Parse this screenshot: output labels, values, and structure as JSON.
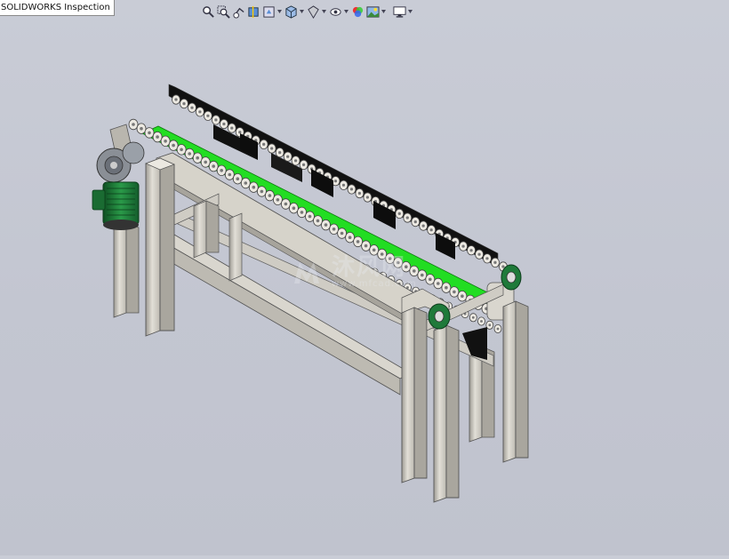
{
  "window": {
    "tab_label": "SOLIDWORKS Inspection"
  },
  "toolbar": {
    "buttons": [
      {
        "icon": "zoom-to-fit-icon"
      },
      {
        "icon": "zoom-to-area-icon"
      },
      {
        "icon": "previous-view-icon"
      },
      {
        "icon": "section-view-icon"
      },
      {
        "icon": "dynamic-annotation-views-icon",
        "dropdown": true
      },
      {
        "icon": "view-orientation-icon",
        "dropdown": true
      },
      {
        "icon": "display-style-icon",
        "dropdown": true
      },
      {
        "icon": "hide-show-items-icon",
        "dropdown": true
      },
      {
        "icon": "edit-appearance-icon",
        "dropdown": true
      },
      {
        "icon": "apply-scene-icon",
        "dropdown": true
      },
      {
        "icon": "view-settings-icon",
        "dropdown": true
      }
    ]
  },
  "model": {
    "name": "roller-conveyor-assembly",
    "colors": {
      "frame": "#d6d3ca",
      "belt": "#22dd22",
      "roller": "#ece9e2",
      "side_plate": "#111111",
      "motor": "#1f7a3a",
      "gearbox": "#8a8f96"
    }
  },
  "watermark": {
    "main": "沐风网",
    "sub": "www.mfcad.com"
  }
}
